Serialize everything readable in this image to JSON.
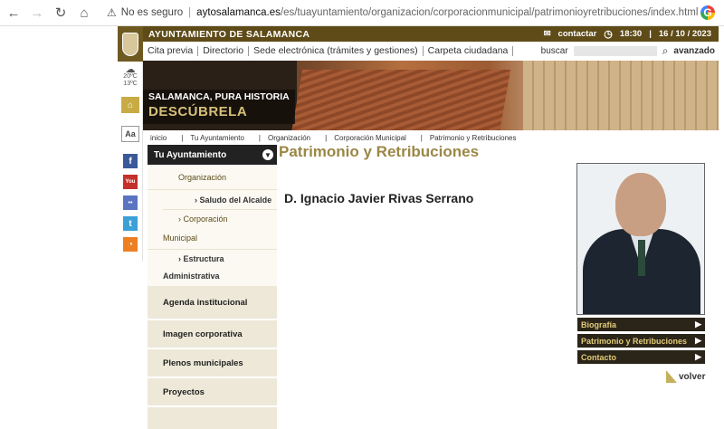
{
  "browser": {
    "warning": "No es seguro",
    "url_domain": "aytosalamanca.es",
    "url_path": "/es/tuayuntamiento/organizacion/corporacionmunicipal/patrimonioyretribuciones/index.html"
  },
  "header": {
    "title": "AYUNTAMIENTO DE SALAMANCA",
    "contact": "contactar",
    "time": "18:30",
    "date": "16 / 10 / 2023"
  },
  "weather": {
    "high": "20ºC",
    "low": "13ºC"
  },
  "menu": {
    "items": [
      "Cita previa",
      "Directorio",
      "Sede electrónica (trámites y gestiones)",
      "Carpeta ciudadana"
    ],
    "search_label": "buscar",
    "advanced": "avanzado"
  },
  "banner": {
    "line1": "SALAMANCA, PURA HISTORIA",
    "line2": "DESCÚBRELA"
  },
  "breadcrumb": [
    "inicio",
    "Tu Ayuntamiento",
    "Organización",
    "Corporación Municipal",
    "Patrimonio y Retribuciones"
  ],
  "sidenav": {
    "head": "Tu Ayuntamiento",
    "sub": {
      "org": "Organización",
      "saludo": "› Saludo del Alcalde",
      "corp1": "› Corporación",
      "corp2": "Municipal",
      "estr1": "› Estructura",
      "estr2": "Administrativa"
    },
    "big": [
      "Agenda institucional",
      "Imagen corporativa",
      "Plenos municipales",
      "Proyectos"
    ]
  },
  "content": {
    "title": "Patrimonio y Retribuciones",
    "person": "D. Ignacio Javier Rivas Serrano"
  },
  "rightnav": {
    "items": [
      "Biografía",
      "Patrimonio y Retribuciones",
      "Contacto"
    ],
    "back": "volver"
  },
  "colors": {
    "brand": "#5e4b17",
    "accent": "#9b8746"
  }
}
